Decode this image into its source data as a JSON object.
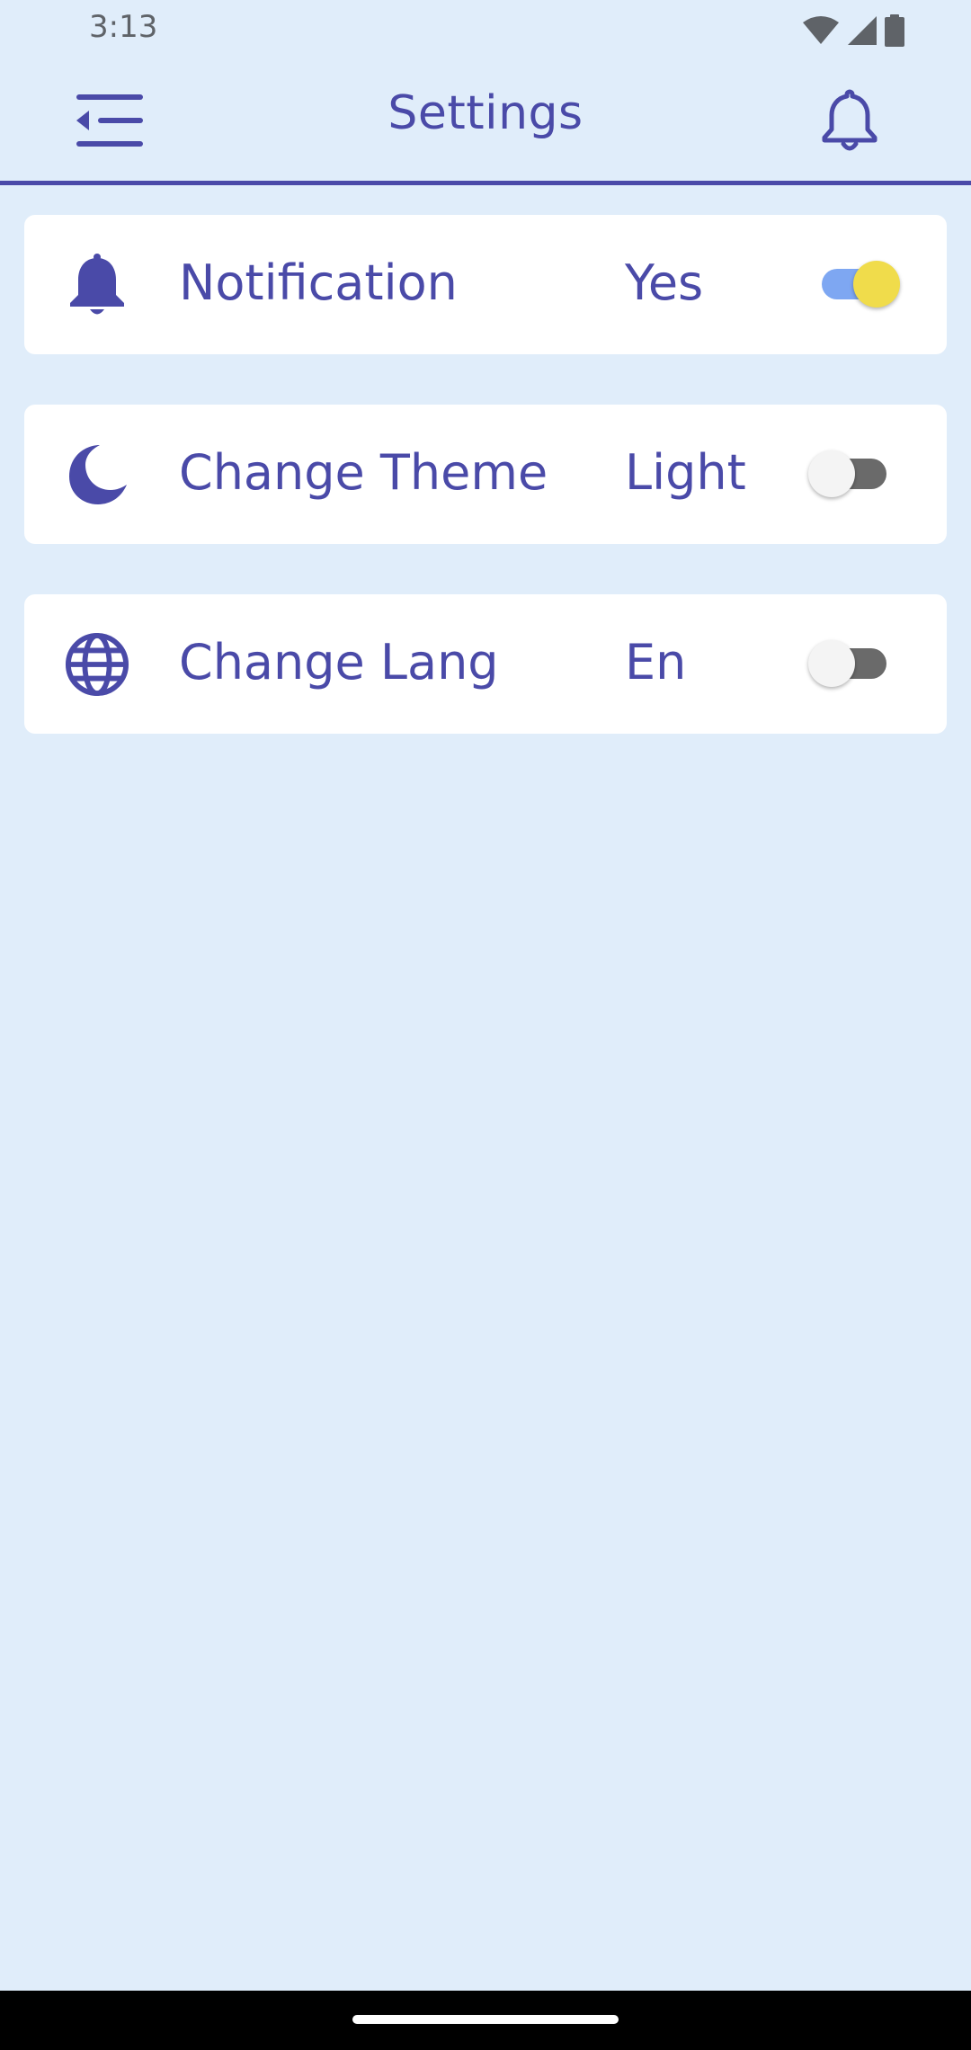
{
  "status_bar": {
    "time": "3:13",
    "icons": [
      "wifi-icon",
      "signal-icon",
      "battery-icon"
    ]
  },
  "app_bar": {
    "title": "Settings",
    "left_icon": "menu-collapse-icon",
    "right_icon": "bell-outline-icon"
  },
  "settings": [
    {
      "icon": "bell-icon",
      "label": "Notification",
      "value": "Yes",
      "enabled": true
    },
    {
      "icon": "moon-icon",
      "label": "Change Theme",
      "value": "Light",
      "enabled": false
    },
    {
      "icon": "globe-icon",
      "label": "Change Lang",
      "value": "En",
      "enabled": false
    }
  ],
  "colors": {
    "background": "#e0edfa",
    "accent": "#4a4aa8",
    "card": "#ffffff",
    "toggle_on_track": "#7ea7f2",
    "toggle_on_thumb": "#f0dc4b",
    "toggle_off_track": "#6a6a6a",
    "toggle_off_thumb": "#f4f4f4"
  }
}
